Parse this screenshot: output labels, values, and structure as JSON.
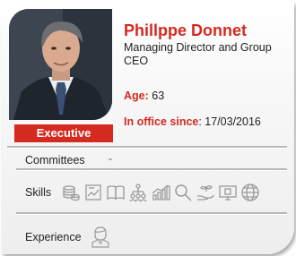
{
  "person": {
    "name": "Phillppe Donnet",
    "role": "Managing Director and Group CEO",
    "age_label": "Age:",
    "age_value": "63",
    "office_label": "In office since",
    "office_value": ": 17/03/2016",
    "badge": "Executive"
  },
  "sections": {
    "committees_label": "Committees",
    "committees_value": "-",
    "skills_label": "Skills",
    "experience_label": "Experience"
  },
  "skill_icons": [
    "coins-stack-icon",
    "chart-document-icon",
    "open-book-icon",
    "org-chart-icon",
    "growth-bars-icon",
    "magnifier-icon",
    "hand-plant-icon",
    "monitor-icon",
    "globe-icon"
  ],
  "experience_icon": "person-portrait-icon",
  "colors": {
    "accent": "#d42a20",
    "text": "#222222",
    "icon": "#9a9a9a"
  }
}
